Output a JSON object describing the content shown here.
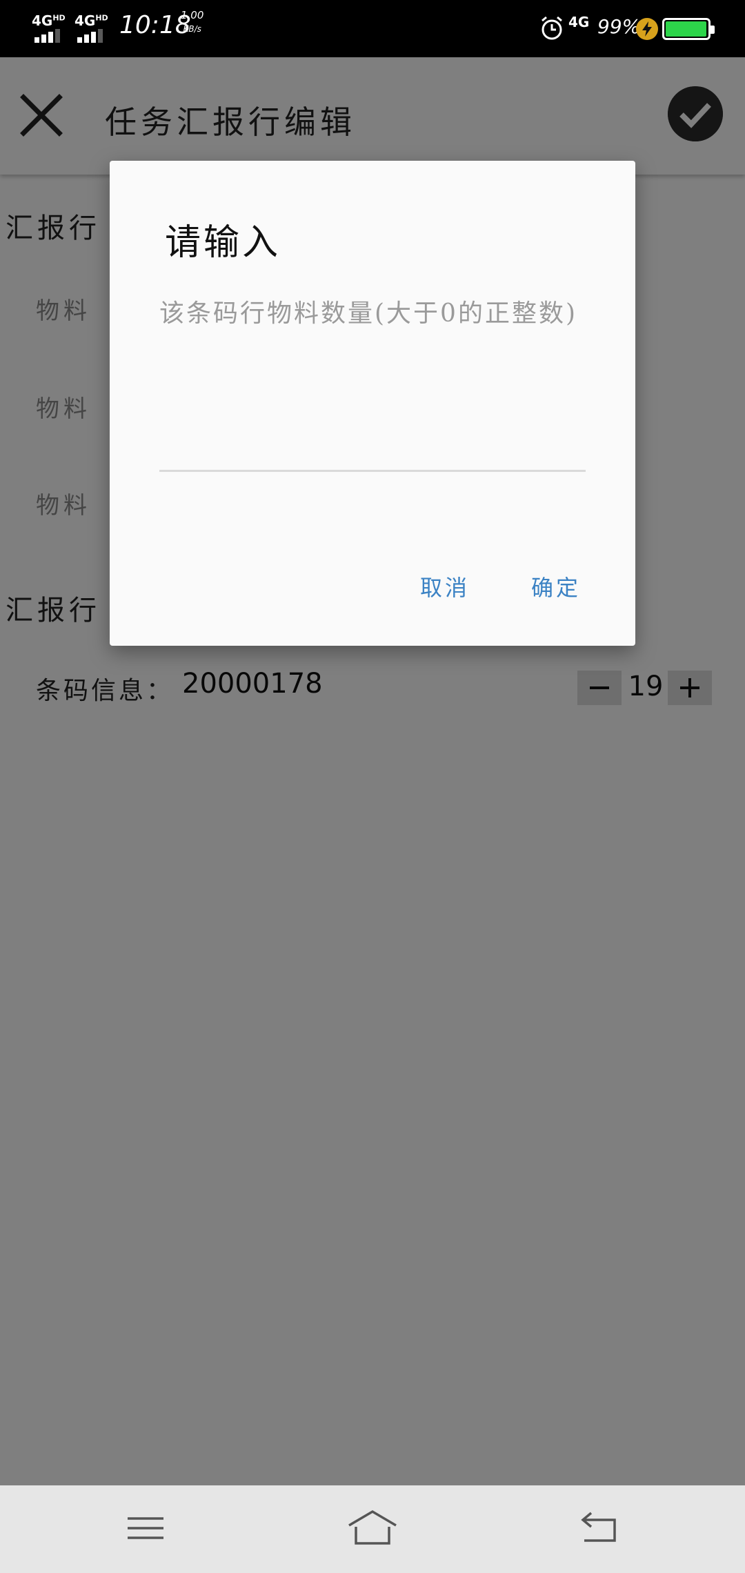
{
  "status_bar": {
    "sim1": "4G",
    "sim1_sup": "HD",
    "sim2": "4G",
    "sim2_sup": "HD",
    "time": "10:18",
    "speed_value": "1.00",
    "speed_unit": "KB/s",
    "network": "4G",
    "battery_pct": "99%",
    "battery_level": 0.99,
    "battery_color": "#2dd44a",
    "icons": [
      "alarm-icon",
      "charging-icon",
      "battery-icon"
    ]
  },
  "app_bar": {
    "title": "任务汇报行编辑",
    "close_icon": "close-icon",
    "confirm_icon": "check-circle-icon"
  },
  "content": {
    "section1_title": "汇报行",
    "fields": [
      {
        "label": "物料"
      },
      {
        "label": "物料"
      },
      {
        "label": "物料"
      }
    ],
    "section2_title": "汇报行",
    "barcode_label": "条码信息：",
    "barcode_value": "20000178",
    "quantity": "19",
    "minus_label": "−",
    "plus_label": "+"
  },
  "dialog": {
    "title": "请输入",
    "placeholder": "该条码行物料数量(大于0的正整数)",
    "cancel": "取消",
    "ok": "确定",
    "accent": "#3b82c4"
  },
  "nav_bar": {
    "icons": [
      "menu-icon",
      "home-icon",
      "back-icon"
    ]
  }
}
